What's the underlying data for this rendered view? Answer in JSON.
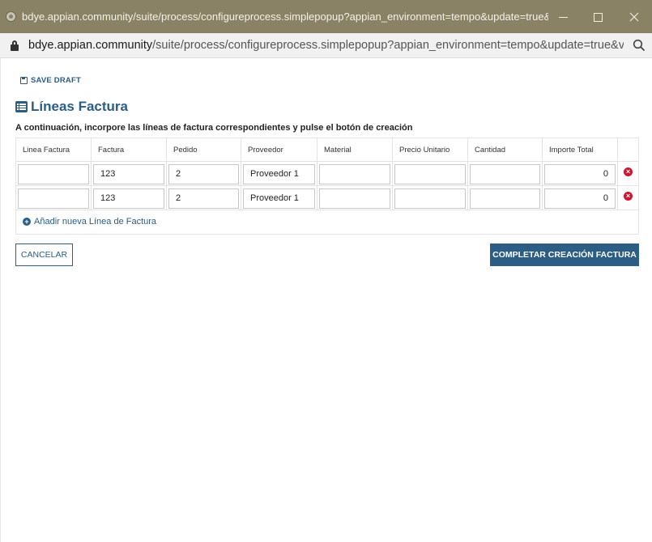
{
  "window": {
    "title": "bdye.appian.community/suite/process/configureprocess.simplepopup?appian_environment=tempo&update=true&vers..."
  },
  "address_bar": {
    "host": "bdye.appian.community",
    "path": "/suite/process/configureprocess.simplepopup?appian_environment=tempo&update=true&v..."
  },
  "toolbar": {
    "save_draft_label": "SAVE DRAFT"
  },
  "section": {
    "title": "Líneas Factura",
    "instructions": "A continuación, incorpore las líneas de factura correspondientes y pulse el botón de creación"
  },
  "grid": {
    "columns": [
      "Linea Factura",
      "Factura",
      "Pedido",
      "Proveedor",
      "Material",
      "Precio Unitario",
      "Cantidad",
      "Importe Total"
    ],
    "rows": [
      {
        "linea_factura": "",
        "factura": "123",
        "pedido": "2",
        "proveedor": "Proveedor 1",
        "material": "",
        "precio_unitario": "",
        "cantidad": "",
        "importe_total": "0"
      },
      {
        "linea_factura": "",
        "factura": "123",
        "pedido": "2",
        "proveedor": "Proveedor 1",
        "material": "",
        "precio_unitario": "",
        "cantidad": "",
        "importe_total": "0"
      }
    ],
    "add_row_label": "Añadir nueva Línea de Factura"
  },
  "buttons": {
    "cancel_label": "CANCELAR",
    "submit_label": "COMPLETAR CREACIÓN FACTURA"
  },
  "colors": {
    "accent": "#2b5d85",
    "titlebar": "#8a8265",
    "delete": "#d0132f"
  }
}
